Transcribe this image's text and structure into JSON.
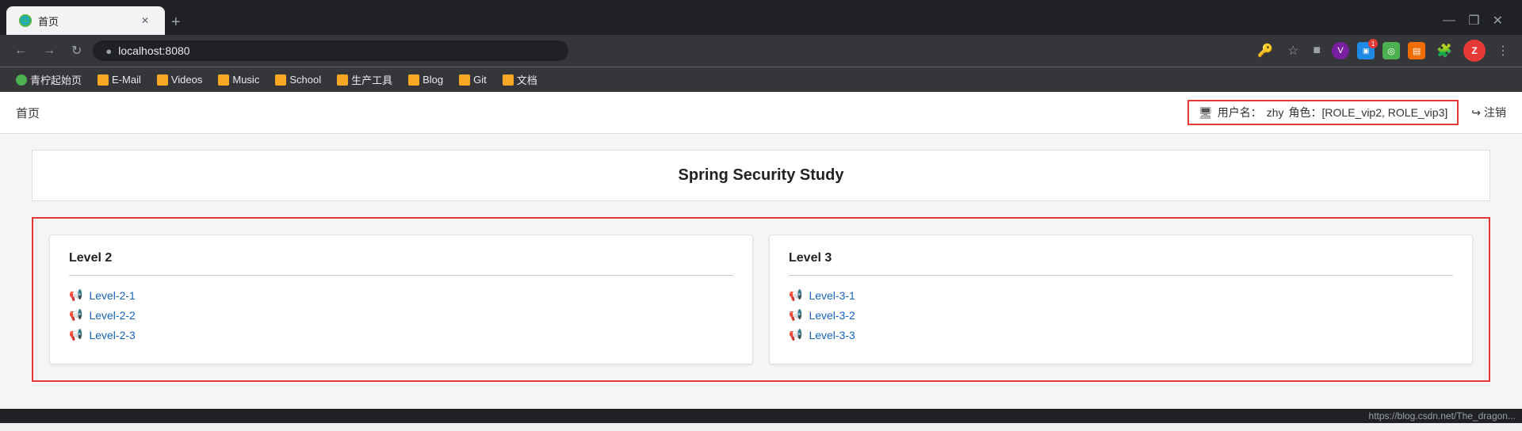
{
  "browser": {
    "tab_title": "首页",
    "new_tab_label": "+",
    "address": "localhost:8080",
    "window_minimize": "—",
    "window_restore": "❐",
    "window_close": "✕"
  },
  "bookmarks": [
    {
      "label": "青柠起始页",
      "type": "green"
    },
    {
      "label": "E-Mail",
      "type": "folder"
    },
    {
      "label": "Videos",
      "type": "folder"
    },
    {
      "label": "Music",
      "type": "folder"
    },
    {
      "label": "School",
      "type": "folder"
    },
    {
      "label": "生产工具",
      "type": "folder"
    },
    {
      "label": "Blog",
      "type": "folder"
    },
    {
      "label": "Git",
      "type": "folder"
    },
    {
      "label": "文档",
      "type": "folder"
    }
  ],
  "topnav": {
    "home_link": "首页",
    "user_label": "用户名：",
    "username": "zhy",
    "role_label": "角色：[ROLE_vip2, ROLE_vip3]",
    "logout_label": "注销"
  },
  "main": {
    "title": "Spring Security Study",
    "cards": [
      {
        "title": "Level 2",
        "links": [
          "Level-2-1",
          "Level-2-2",
          "Level-2-3"
        ]
      },
      {
        "title": "Level 3",
        "links": [
          "Level-3-1",
          "Level-3-2",
          "Level-3-3"
        ]
      }
    ]
  },
  "statusbar": {
    "url": "https://blog.csdn.net/The_dragon..."
  }
}
